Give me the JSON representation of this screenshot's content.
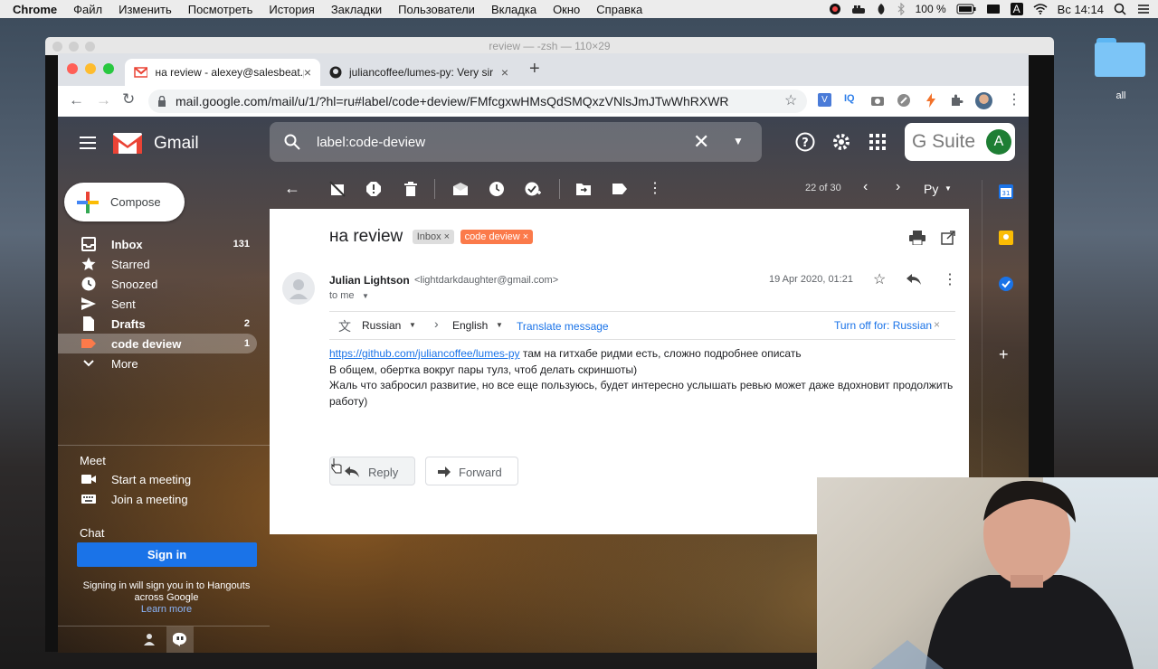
{
  "menubar": {
    "app": "Chrome",
    "items": [
      "Файл",
      "Изменить",
      "Посмотреть",
      "История",
      "Закладки",
      "Пользователи",
      "Вкладка",
      "Окно",
      "Справка"
    ],
    "battery": "100 %",
    "input_lang": "A",
    "clock": "Вс 14:14"
  },
  "desktop": {
    "folder_label": "all"
  },
  "terminal": {
    "title": "review — -zsh — 110×29"
  },
  "chrome": {
    "tabs": [
      {
        "title": "на review - alexey@salesbeat.p"
      },
      {
        "title": "juliancoffee/lumes-py: Very sir"
      }
    ],
    "url": "mail.google.com/mail/u/1/?hl=ru#label/code+deview/FMfcgxwHMsQdSMQxzVNlsJmJTwWhRXWR"
  },
  "gmail": {
    "logo_text": "Gmail",
    "search_value": "label:code-deview",
    "gsuite_label": "G Suite",
    "avatar_letter": "A",
    "compose_label": "Compose",
    "nav": [
      {
        "label": "Inbox",
        "count": "131"
      },
      {
        "label": "Starred",
        "count": ""
      },
      {
        "label": "Snoozed",
        "count": ""
      },
      {
        "label": "Sent",
        "count": ""
      },
      {
        "label": "Drafts",
        "count": "2"
      },
      {
        "label": "code deview",
        "count": "1"
      },
      {
        "label": "More",
        "count": ""
      }
    ],
    "meet": {
      "title": "Meet",
      "start": "Start a meeting",
      "join": "Join a meeting"
    },
    "chat": {
      "title": "Chat",
      "signin_button": "Sign in",
      "signin_text": "Signing in will sign you in to Hangouts across Google",
      "learn_more": "Learn more"
    },
    "pager": "22 of 30",
    "lang_button": "Ру",
    "message": {
      "subject": "на review",
      "labels": [
        {
          "name": "Inbox",
          "color": "#dddddd"
        },
        {
          "name": "code deview",
          "color": "#fb7a4a"
        }
      ],
      "sender_name": "Julian Lightson",
      "sender_email": "<lightdarkdaughter@gmail.com>",
      "date": "19 Apr 2020, 01:21",
      "to": "to me",
      "translate": {
        "from": "Russian",
        "to": "English",
        "action": "Translate message",
        "turn_off": "Turn off for: Russian"
      },
      "link": "https://github.com/juliancoffee/lumes-py",
      "line1_rest": " там на гитхабе ридми есть, сложно подробнее описать",
      "line2": "В общем, обертка вокруг пары тулз, чтоб делать скриншоты)",
      "line3": "Жаль что забросил развитие, но все еще пользуюсь, будет интересно услышать ревью может даже вдохновит продолжить работу)",
      "reply": "Reply",
      "forward": "Forward"
    }
  },
  "colors": {
    "gmail_red": "#ea4335",
    "link_blue": "#1a73e8",
    "signin_blue": "#1a73e8",
    "code_label": "#fb7a4a"
  }
}
